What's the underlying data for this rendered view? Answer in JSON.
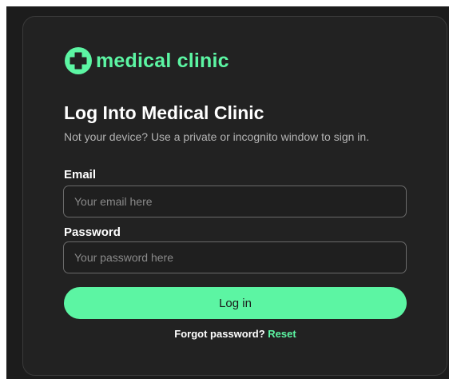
{
  "brand": {
    "name": "medical clinic",
    "icon": "medical-cross-icon",
    "accent_color": "#5cf5a3"
  },
  "heading": {
    "title": "Log Into Medical Clinic",
    "subtitle": "Not your device? Use a private or incognito window to sign in."
  },
  "form": {
    "email": {
      "label": "Email",
      "placeholder": "Your email here",
      "value": ""
    },
    "password": {
      "label": "Password",
      "placeholder": "Your password here",
      "value": ""
    },
    "submit_label": "Log in"
  },
  "footer": {
    "forgot_text": "Forgot password?",
    "reset_label": "Reset"
  },
  "colors": {
    "background": "#1c1c1c",
    "card": "#222222",
    "accent": "#5cf5a3"
  }
}
